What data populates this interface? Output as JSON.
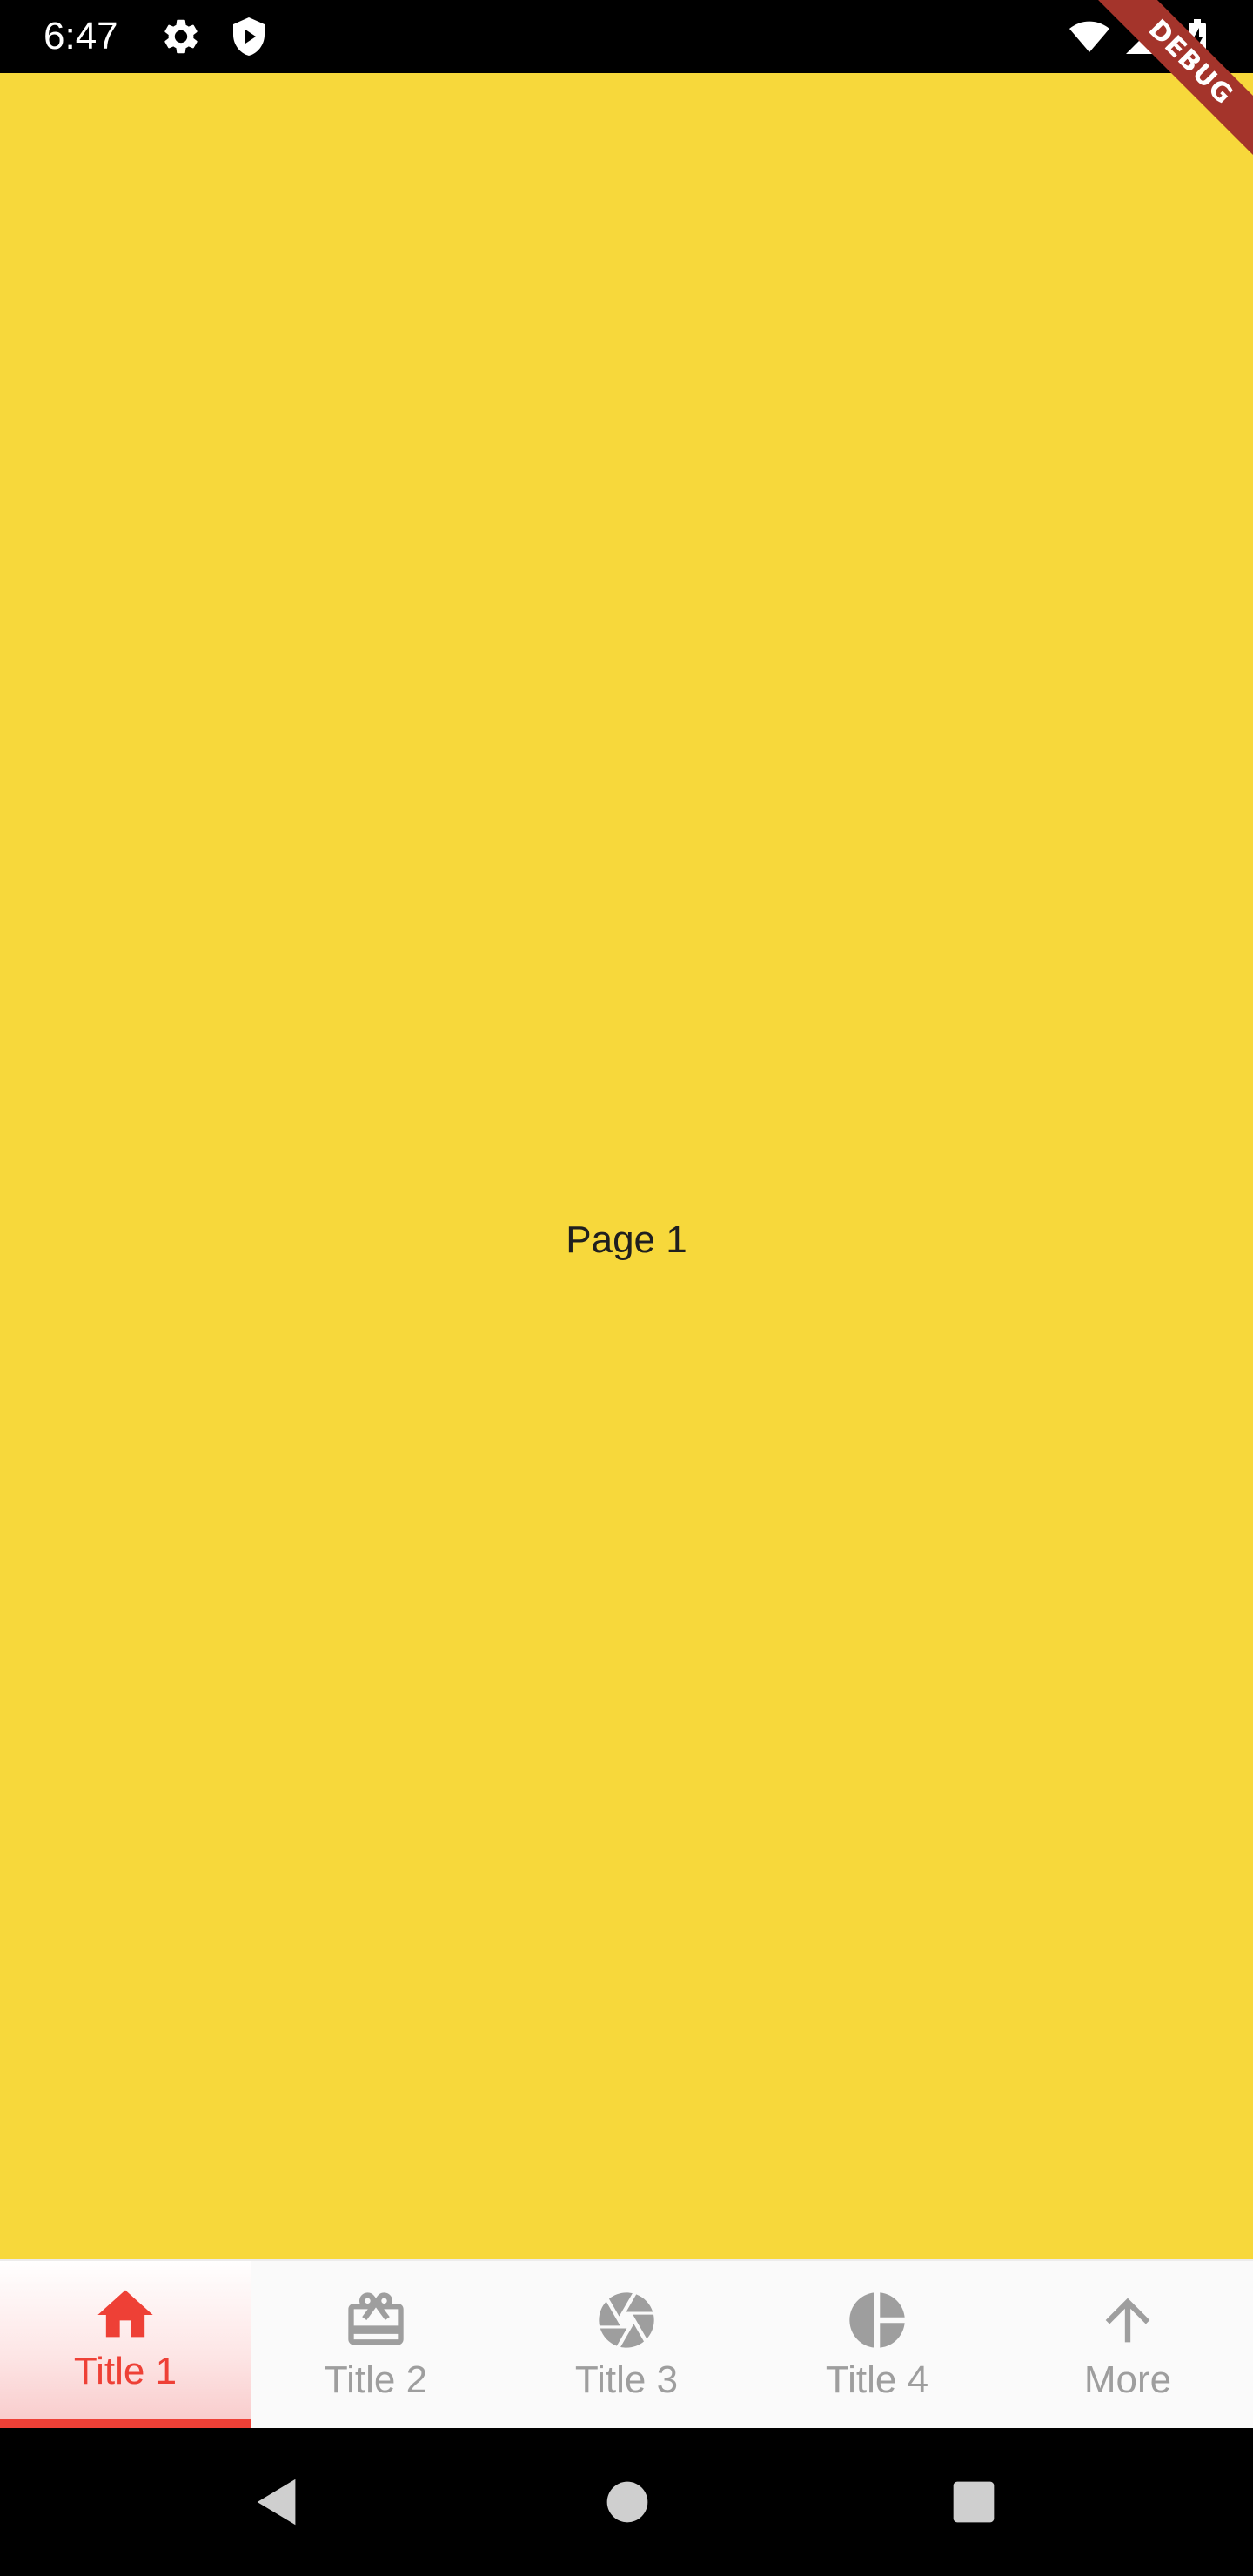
{
  "status_bar": {
    "time": "6:47",
    "icons": [
      "gear-icon",
      "shield-play-icon",
      "wifi-icon",
      "signal-icon",
      "battery-charging-icon"
    ]
  },
  "debug_banner": {
    "label": "DEBUG",
    "color": "#a4342b"
  },
  "page": {
    "label": "Page 1",
    "background": "#f7d83b"
  },
  "bottom_nav": {
    "active_color": "#ee4036",
    "inactive_color": "#9e9e9e",
    "items": [
      {
        "label": "Title 1",
        "icon": "home-icon",
        "active": true
      },
      {
        "label": "Title 2",
        "icon": "card-giftcard-icon",
        "active": false
      },
      {
        "label": "Title 3",
        "icon": "camera-aperture-icon",
        "active": false
      },
      {
        "label": "Title 4",
        "icon": "pie-chart-icon",
        "active": false
      },
      {
        "label": "More",
        "icon": "arrow-up-icon",
        "active": false
      }
    ]
  },
  "system_nav": {
    "buttons": [
      "back-icon",
      "home-circle-icon",
      "recents-icon"
    ]
  }
}
